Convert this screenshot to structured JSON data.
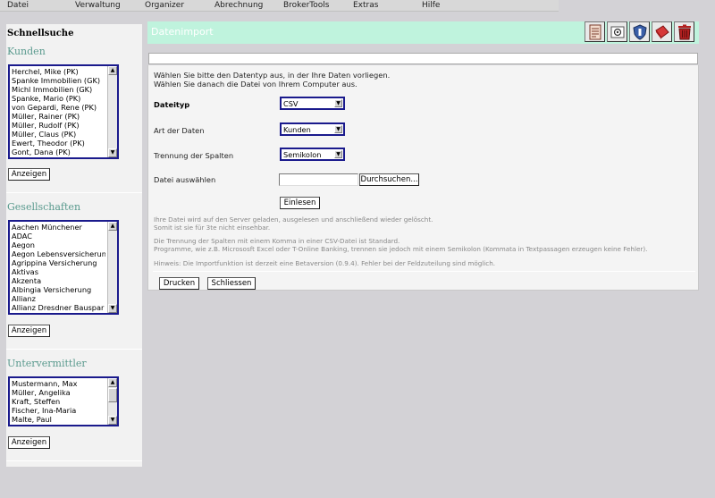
{
  "menu": [
    "Datei",
    "Verwaltung",
    "Organizer",
    "Abrechnung",
    "BrokerTools",
    "Extras",
    "Hilfe"
  ],
  "sidebar": {
    "title": "Schnellsuche",
    "sections": [
      {
        "heading": "Kunden",
        "items": [
          "Herchel, Mike (PK)",
          "Spanke Immobilien (GK)",
          "Michl Immobilien (GK)",
          "Spanke, Mario (PK)",
          "von Gepardi, Rene (PK)",
          "Müller, Rainer (PK)",
          "Müller, Rudolf (PK)",
          "Müller, Claus (PK)",
          "Ewert, Theodor (PK)",
          "Gont, Dana (PK)"
        ],
        "button": "Anzeigen"
      },
      {
        "heading": "Gesellschaften",
        "items": [
          "Aachen Münchener",
          "ADAC",
          "Aegon",
          "Aegon Lebensversicherungs",
          "Agrippina Versicherung",
          "Aktivas",
          "Akzenta",
          "Albingia Versicherung",
          "Allianz",
          "Allianz Dresdner Bauspar AG"
        ],
        "button": "Anzeigen"
      },
      {
        "heading": "Untervermittler",
        "items": [
          "Mustermann, Max",
          "Müller, Angelika",
          "Kraft, Steffen",
          "Fischer, Ina-Maria",
          "Malte, Paul"
        ],
        "button": "Anzeigen"
      }
    ]
  },
  "panel": {
    "title": "Datenimport",
    "intro_line1": "Wählen Sie bitte den Datentyp aus, in der Ihre Daten vorliegen.",
    "intro_line2": "Wählen Sie danach die Datei von Ihrem Computer aus.",
    "fields": {
      "dateityp_label": "Dateityp",
      "dateityp_value": "CSV",
      "art_label": "Art der Daten",
      "art_value": "Kunden",
      "trennung_label": "Trennung der Spalten",
      "trennung_value": "Semikolon",
      "datei_label": "Datei auswählen",
      "file_value": "",
      "browse_button": "Durchsuchen...",
      "read_button": "Einlesen"
    },
    "notes": {
      "n1a": "Ihre Datei wird auf den Server geladen, ausgelesen und anschließend wieder gelöscht.",
      "n1b": "Somit ist sie für 3te nicht einsehbar.",
      "n2a": "Die Trennung der Spalten mit einem Komma in einer CSV-Datei ist Standard.",
      "n2b": "Programme, wie z.B. Micrososft Excel oder T-Online Banking, trennen sie jedoch mit einem Semikolon (Kommata in Textpassagen erzeugen keine Fehler).",
      "n3": "Hinweis: Die Importfunktion ist derzeit eine Betaversion (0.9.4). Fehler bei der Feldzuteilung sind möglich."
    },
    "print_button": "Drucken",
    "close_button": "Schliessen"
  },
  "toolbar_icons": [
    "document-icon",
    "email-icon",
    "shield-icon",
    "notebook-icon",
    "trash-icon"
  ],
  "colors": {
    "header_bg": "#bff3dd",
    "heading_teal": "#5a9a8e",
    "select_border": "#1a1a8c",
    "trash_red": "#b32020"
  }
}
